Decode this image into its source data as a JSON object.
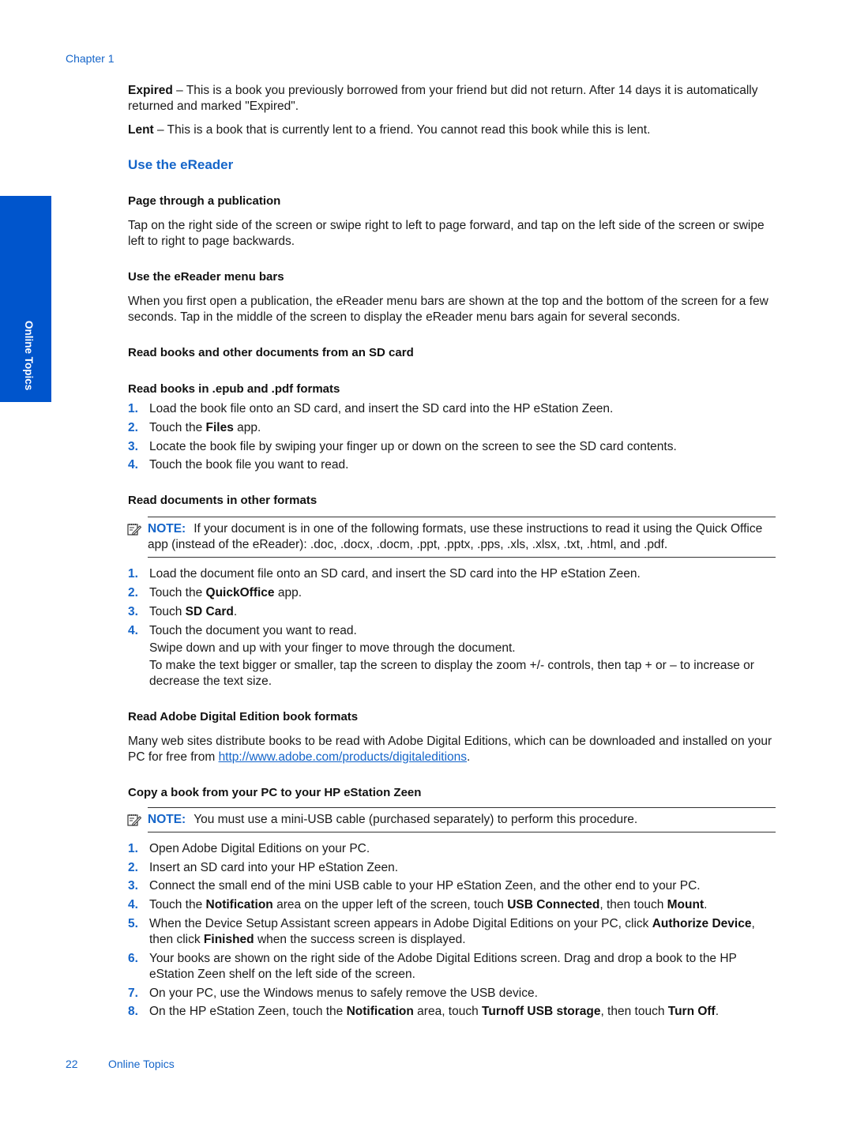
{
  "header": {
    "chapter": "Chapter 1"
  },
  "side_tab": {
    "label": "Online Topics",
    "color": "#0055cc"
  },
  "intro": {
    "expired": {
      "term": "Expired",
      "text": " – This is a book you previously borrowed from your friend but did not return. After 14 days it is automatically returned and marked \"Expired\"."
    },
    "lent": {
      "term": "Lent",
      "text": " – This is a book that is currently lent to a friend. You cannot read this book while this is lent."
    }
  },
  "section_title": "Use the eReader",
  "page_through": {
    "heading": "Page through a publication",
    "text": "Tap on the right side of the screen or swipe right to left to page forward, and tap on the left side of the screen or swipe left to right to page backwards."
  },
  "menu_bars": {
    "heading": "Use the eReader menu bars",
    "text": "When you first open a publication, the eReader menu bars are shown at the top and the bottom of the screen for a few seconds. Tap in the middle of the screen to display the eReader menu bars again for several seconds."
  },
  "sd_card": {
    "heading": "Read books and other documents from an SD card"
  },
  "epub_pdf": {
    "heading": "Read books in .epub and .pdf formats",
    "steps": [
      {
        "num": "1.",
        "pre": "Load the book file onto an SD card, and insert the SD card into the HP eStation Zeen.",
        "bold": "",
        "post": ""
      },
      {
        "num": "2.",
        "pre": "Touch the  ",
        "bold": "Files",
        "post": " app."
      },
      {
        "num": "3.",
        "pre": "Locate the book file by swiping your finger up or down on the screen to see the SD card contents.",
        "bold": "",
        "post": ""
      },
      {
        "num": "4.",
        "pre": "Touch the book file you want to read.",
        "bold": "",
        "post": ""
      }
    ]
  },
  "other_formats": {
    "heading": "Read documents in other formats",
    "note_label": "NOTE:",
    "note_text": "If your document is in one of the following formats, use these instructions to read it using the Quick Office app (instead of the eReader): .doc, .docx, .docm, .ppt, .pptx, .pps, .xls, .xlsx, .txt, .html, and .pdf.",
    "steps": [
      {
        "num": "1.",
        "pre": "Load the document file onto an SD card, and insert the SD card into the HP eStation Zeen.",
        "bold": "",
        "post": ""
      },
      {
        "num": "2.",
        "pre": "Touch the ",
        "bold": "QuickOffice",
        "post": " app."
      },
      {
        "num": "3.",
        "pre": "Touch ",
        "bold": "SD Card",
        "post": "."
      },
      {
        "num": "4.",
        "pre": "Touch the document you want to read.",
        "bold": "",
        "post": ""
      }
    ],
    "step4_sub1": "Swipe down and up with your finger to move through the document.",
    "step4_sub2": "To make the text bigger or smaller, tap the screen to display the zoom +/- controls, then tap + or – to increase or decrease the text size."
  },
  "adobe": {
    "heading": "Read Adobe Digital Edition book formats",
    "text_pre": "Many web sites distribute books to be read with Adobe Digital Editions, which can be downloaded and installed on your PC for free from ",
    "link": "http://www.adobe.com/products/digitaleditions",
    "text_post": "."
  },
  "copy_book": {
    "heading": "Copy a book from your PC to your HP eStation Zeen",
    "note_label": "NOTE:",
    "note_text": "You must use a mini-USB cable (purchased separately) to perform this procedure.",
    "steps": [
      {
        "num": "1.",
        "parts": [
          {
            "t": "Open Adobe Digital Editions on your PC."
          }
        ]
      },
      {
        "num": "2.",
        "parts": [
          {
            "t": "Insert an SD card into your HP eStation Zeen."
          }
        ]
      },
      {
        "num": "3.",
        "parts": [
          {
            "t": "Connect the small end of the mini USB cable to your HP eStation Zeen, and the other end to your PC."
          }
        ]
      },
      {
        "num": "4.",
        "parts": [
          {
            "t": "Touch the  "
          },
          {
            "b": "Notification"
          },
          {
            "t": " area on the upper left of the screen, touch "
          },
          {
            "b": "USB Connected"
          },
          {
            "t": ", then touch  "
          },
          {
            "b": "Mount"
          },
          {
            "t": "."
          }
        ]
      },
      {
        "num": "5.",
        "parts": [
          {
            "t": "When the Device Setup Assistant screen appears in Adobe Digital Editions on your PC, click "
          },
          {
            "b": "Authorize Device"
          },
          {
            "t": ", then click "
          },
          {
            "b": "Finished"
          },
          {
            "t": " when the success screen is displayed."
          }
        ]
      },
      {
        "num": "6.",
        "parts": [
          {
            "t": "Your books are shown on the right side of the Adobe Digital Editions screen. Drag and drop a book to the HP eStation Zeen shelf on the left side of the screen."
          }
        ]
      },
      {
        "num": "7.",
        "parts": [
          {
            "t": "On your PC, use the Windows menus to safely remove the USB device."
          }
        ]
      },
      {
        "num": "8.",
        "parts": [
          {
            "t": "On the HP eStation Zeen, touch the "
          },
          {
            "b": "Notification"
          },
          {
            "t": " area, touch "
          },
          {
            "b": "Turnoff USB storage"
          },
          {
            "t": ", then touch  "
          },
          {
            "b": "Turn Off"
          },
          {
            "t": "."
          }
        ]
      }
    ]
  },
  "footer": {
    "page_number": "22",
    "section": "Online Topics"
  },
  "icons": {
    "note": "note-pencil-icon"
  }
}
